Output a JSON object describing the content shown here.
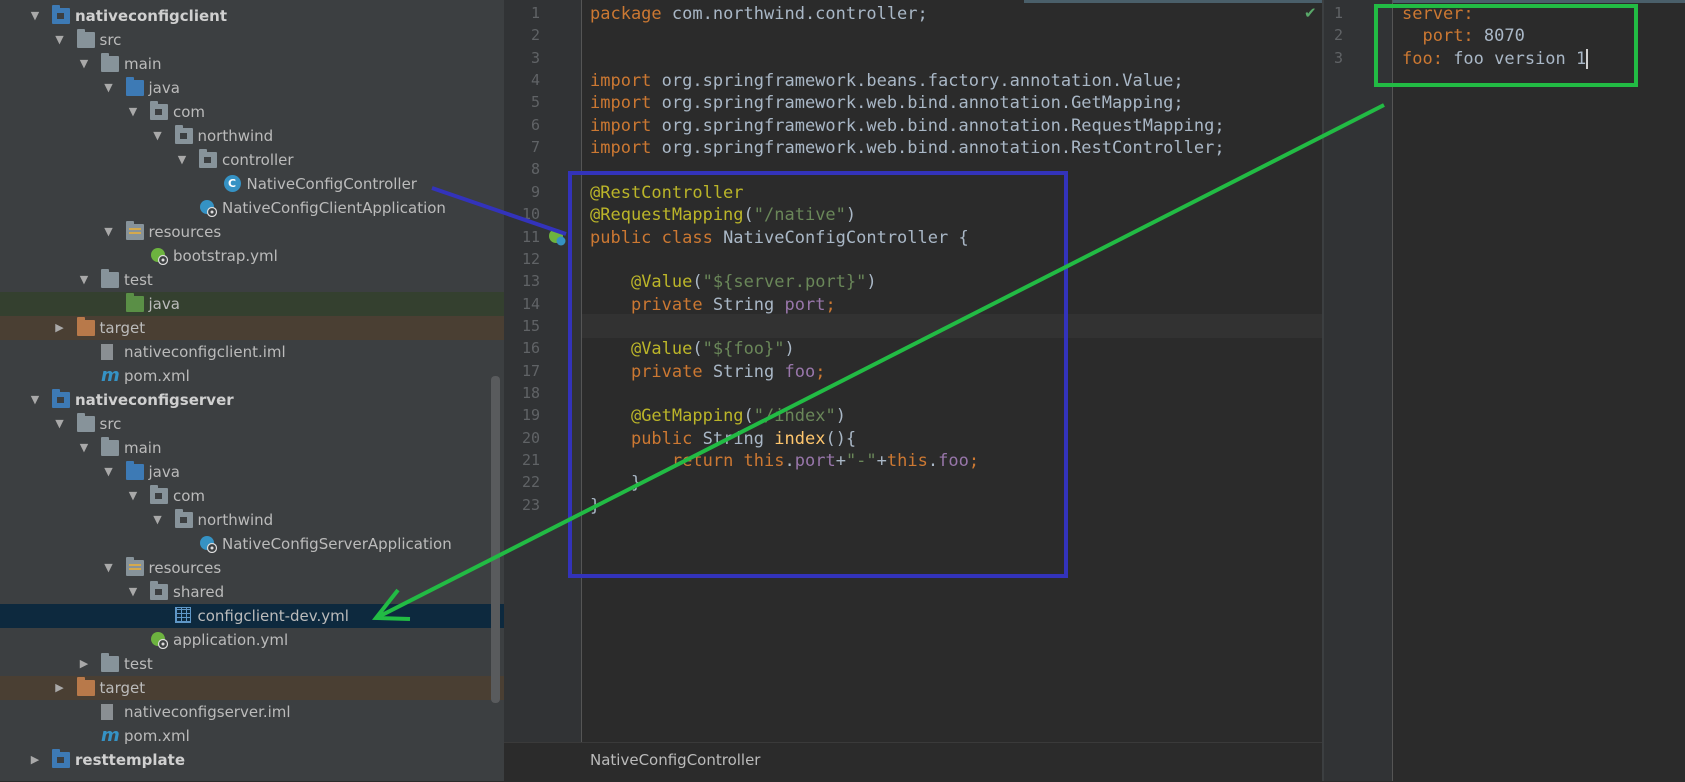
{
  "project_tree": {
    "rows": [
      {
        "label": "nativeconfigclient",
        "indent": 0,
        "arrow": "down",
        "icon": "module-folder-icon",
        "bold": true
      },
      {
        "label": "src",
        "indent": 1,
        "arrow": "down",
        "icon": "folder-icon"
      },
      {
        "label": "main",
        "indent": 2,
        "arrow": "down",
        "icon": "folder-icon"
      },
      {
        "label": "java",
        "indent": 3,
        "arrow": "down",
        "icon": "source-folder-icon"
      },
      {
        "label": "com",
        "indent": 4,
        "arrow": "down",
        "icon": "package-icon"
      },
      {
        "label": "northwind",
        "indent": 5,
        "arrow": "down",
        "icon": "package-icon"
      },
      {
        "label": "controller",
        "indent": 6,
        "arrow": "down",
        "icon": "package-icon"
      },
      {
        "label": "NativeConfigController",
        "indent": 7,
        "arrow": "none",
        "icon": "class-icon"
      },
      {
        "label": "NativeConfigClientApplication",
        "indent": 6,
        "arrow": "none",
        "icon": "spring-boot-class-icon"
      },
      {
        "label": "resources",
        "indent": 3,
        "arrow": "down",
        "icon": "resources-folder-icon"
      },
      {
        "label": "bootstrap.yml",
        "indent": 4,
        "arrow": "none",
        "icon": "spring-yml-icon"
      },
      {
        "label": "test",
        "indent": 2,
        "arrow": "down",
        "icon": "folder-icon"
      },
      {
        "label": "java",
        "indent": 3,
        "arrow": "none",
        "icon": "test-folder-icon",
        "style": "testsrc"
      },
      {
        "label": "target",
        "indent": 1,
        "arrow": "right",
        "icon": "excluded-folder-icon",
        "style": "excluded"
      },
      {
        "label": "nativeconfigclient.iml",
        "indent": 2,
        "arrow": "none",
        "icon": "iml-file-icon"
      },
      {
        "label": "pom.xml",
        "indent": 2,
        "arrow": "none",
        "icon": "maven-icon"
      },
      {
        "label": "nativeconfigserver",
        "indent": 0,
        "arrow": "down",
        "icon": "module-folder-icon",
        "bold": true
      },
      {
        "label": "src",
        "indent": 1,
        "arrow": "down",
        "icon": "folder-icon"
      },
      {
        "label": "main",
        "indent": 2,
        "arrow": "down",
        "icon": "folder-icon"
      },
      {
        "label": "java",
        "indent": 3,
        "arrow": "down",
        "icon": "source-folder-icon"
      },
      {
        "label": "com",
        "indent": 4,
        "arrow": "down",
        "icon": "package-icon"
      },
      {
        "label": "northwind",
        "indent": 5,
        "arrow": "down",
        "icon": "package-icon"
      },
      {
        "label": "NativeConfigServerApplication",
        "indent": 6,
        "arrow": "none",
        "icon": "spring-boot-class-icon"
      },
      {
        "label": "resources",
        "indent": 3,
        "arrow": "down",
        "icon": "resources-folder-icon"
      },
      {
        "label": "shared",
        "indent": 4,
        "arrow": "down",
        "icon": "package-icon"
      },
      {
        "label": "configclient-dev.yml",
        "indent": 5,
        "arrow": "none",
        "icon": "yml-file-icon",
        "style": "selected"
      },
      {
        "label": "application.yml",
        "indent": 4,
        "arrow": "none",
        "icon": "spring-yml-icon"
      },
      {
        "label": "test",
        "indent": 2,
        "arrow": "right",
        "icon": "folder-icon"
      },
      {
        "label": "target",
        "indent": 1,
        "arrow": "right",
        "icon": "excluded-folder-icon",
        "style": "excluded"
      },
      {
        "label": "nativeconfigserver.iml",
        "indent": 2,
        "arrow": "none",
        "icon": "iml-file-icon"
      },
      {
        "label": "pom.xml",
        "indent": 2,
        "arrow": "none",
        "icon": "maven-icon"
      },
      {
        "label": "resttemplate",
        "indent": 0,
        "arrow": "right",
        "icon": "module-folder-icon",
        "bold": true
      }
    ]
  },
  "java_editor": {
    "lines": [
      [
        [
          "kw",
          "package "
        ],
        [
          "t",
          "com.northwind.controller;"
        ]
      ],
      [],
      [],
      [
        [
          "kw",
          "import "
        ],
        [
          "t",
          "org.springframework.beans.factory.annotation."
        ],
        [
          "t",
          "Value"
        ],
        [
          "t",
          ";"
        ]
      ],
      [
        [
          "kw",
          "import "
        ],
        [
          "t",
          "org.springframework.web.bind.annotation."
        ],
        [
          "t",
          "GetMapping"
        ],
        [
          "t",
          ";"
        ]
      ],
      [
        [
          "kw",
          "import "
        ],
        [
          "t",
          "org.springframework.web.bind.annotation."
        ],
        [
          "t",
          "RequestMapping"
        ],
        [
          "t",
          ";"
        ]
      ],
      [
        [
          "kw",
          "import "
        ],
        [
          "t",
          "org.springframework.web.bind.annotation."
        ],
        [
          "t",
          "RestController"
        ],
        [
          "t",
          ";"
        ]
      ],
      [],
      [
        [
          "ann",
          "@RestController"
        ]
      ],
      [
        [
          "ann",
          "@RequestMapping"
        ],
        [
          "t",
          "("
        ],
        [
          "str",
          "\"/native\""
        ],
        [
          "t",
          ")"
        ]
      ],
      [
        [
          "kw",
          "public class "
        ],
        [
          "t",
          "NativeConfigController {"
        ]
      ],
      [],
      [
        [
          "t",
          "    "
        ],
        [
          "ann",
          "@Value"
        ],
        [
          "t",
          "("
        ],
        [
          "str",
          "\"${server.port}\""
        ],
        [
          "t",
          ")"
        ]
      ],
      [
        [
          "t",
          "    "
        ],
        [
          "kw",
          "private "
        ],
        [
          "t",
          "String "
        ],
        [
          "fld",
          "port"
        ],
        [
          "kw",
          ";"
        ]
      ],
      [],
      [
        [
          "t",
          "    "
        ],
        [
          "ann",
          "@Value"
        ],
        [
          "t",
          "("
        ],
        [
          "str",
          "\"${foo}\""
        ],
        [
          "t",
          ")"
        ]
      ],
      [
        [
          "t",
          "    "
        ],
        [
          "kw",
          "private "
        ],
        [
          "t",
          "String "
        ],
        [
          "fld",
          "foo"
        ],
        [
          "kw",
          ";"
        ]
      ],
      [],
      [
        [
          "t",
          "    "
        ],
        [
          "ann",
          "@GetMapping"
        ],
        [
          "t",
          "("
        ],
        [
          "str",
          "\"/index\""
        ],
        [
          "t",
          ")"
        ]
      ],
      [
        [
          "t",
          "    "
        ],
        [
          "kw",
          "public "
        ],
        [
          "t",
          "String "
        ],
        [
          "fn",
          "index"
        ],
        [
          "t",
          "(){"
        ]
      ],
      [
        [
          "t",
          "        "
        ],
        [
          "kw",
          "return this"
        ],
        [
          "t",
          "."
        ],
        [
          "fld",
          "port"
        ],
        [
          "t",
          "+"
        ],
        [
          "str",
          "\"-\""
        ],
        [
          "t",
          "+"
        ],
        [
          "kw",
          "this"
        ],
        [
          "t",
          "."
        ],
        [
          "fld",
          "foo"
        ],
        [
          "kw",
          ";"
        ]
      ],
      [
        [
          "t",
          "    }"
        ]
      ],
      [
        [
          "t",
          "}"
        ]
      ]
    ],
    "breadcrumb": "NativeConfigController"
  },
  "yaml_editor": {
    "lines": [
      [
        [
          "ykey",
          "server:"
        ]
      ],
      [
        [
          "t",
          "  "
        ],
        [
          "ykey",
          "port:"
        ],
        [
          "t",
          " 8070"
        ]
      ],
      [
        [
          "ykey",
          "foo:"
        ],
        [
          "t",
          " foo version 1"
        ]
      ]
    ]
  },
  "colors": {
    "annotation_blue": "#3333bb",
    "annotation_green": "#22bb44"
  }
}
